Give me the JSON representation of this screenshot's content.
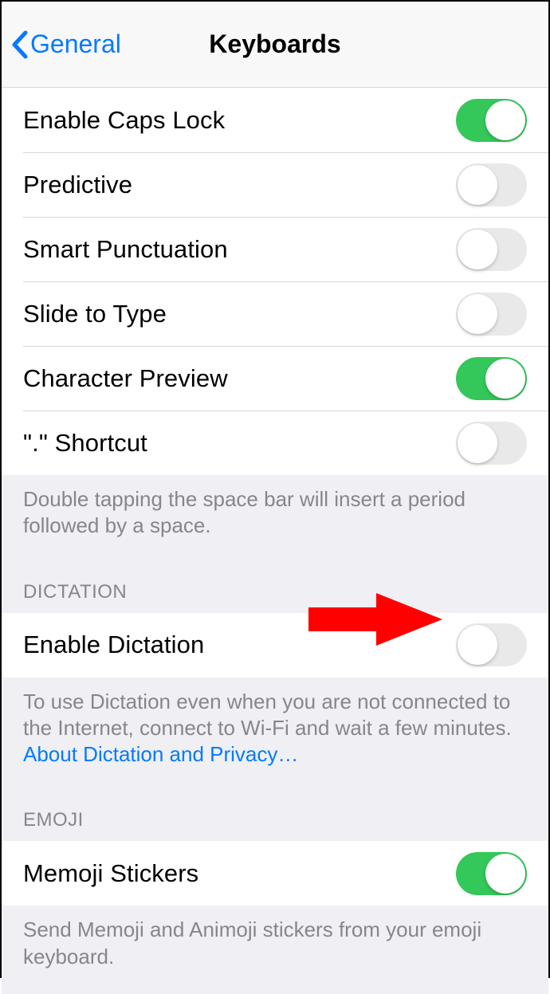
{
  "nav": {
    "back_label": "General",
    "title": "Keyboards"
  },
  "group1": {
    "rows": [
      {
        "label": "Enable Caps Lock",
        "on": true
      },
      {
        "label": "Predictive",
        "on": false
      },
      {
        "label": "Smart Punctuation",
        "on": false
      },
      {
        "label": "Slide to Type",
        "on": false
      },
      {
        "label": "Character Preview",
        "on": true
      },
      {
        "label": "\".\" Shortcut",
        "on": false
      }
    ],
    "footer": "Double tapping the space bar will insert a period followed by a space."
  },
  "group2": {
    "header": "DICTATION",
    "rows": [
      {
        "label": "Enable Dictation",
        "on": false
      }
    ],
    "footer_text": "To use Dictation even when you are not connected to the Internet, connect to Wi-Fi and wait a few minutes.",
    "footer_link": "About Dictation and Privacy…"
  },
  "group3": {
    "header": "EMOJI",
    "rows": [
      {
        "label": "Memoji Stickers",
        "on": true
      }
    ],
    "footer": "Send Memoji and Animoji stickers from your emoji keyboard."
  },
  "colors": {
    "accent": "#047aff",
    "toggle_on": "#34c759",
    "arrow": "#ff0000"
  }
}
